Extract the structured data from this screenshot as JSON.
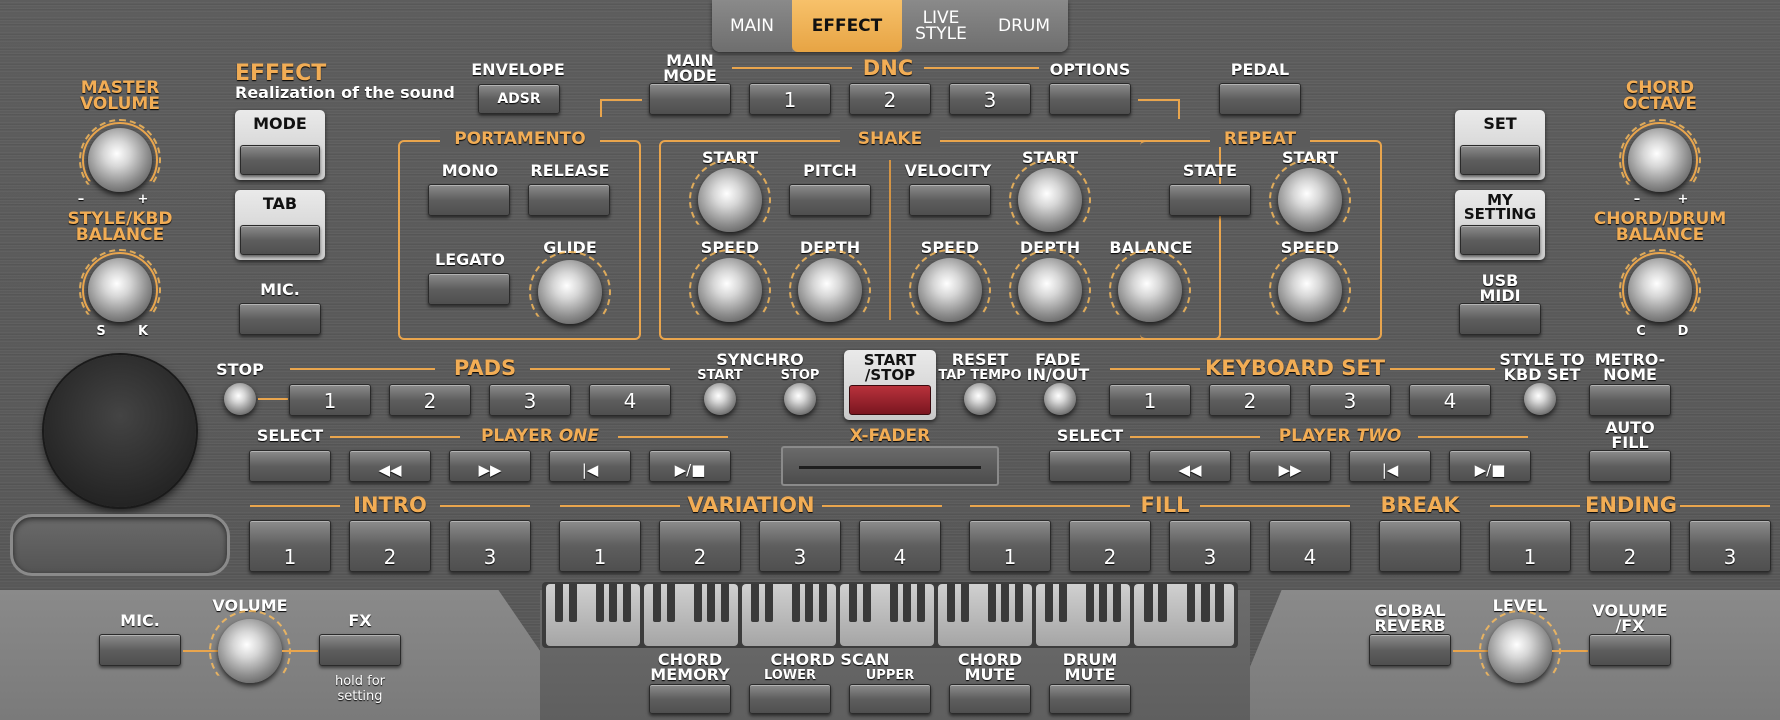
{
  "tabs": [
    {
      "label": "MAIN"
    },
    {
      "label": "EFFECT"
    },
    {
      "label": "LIVE STYLE"
    },
    {
      "label": "DRUM"
    }
  ],
  "left": {
    "master_volume": "MASTER VOLUME",
    "minus": "–",
    "plus": "+",
    "style_kbd_balance": "STYLE/KBD BALANCE",
    "s": "S",
    "k": "K"
  },
  "effect": {
    "title": "EFFECT",
    "subtitle": "Realization of the sound",
    "mode": "MODE",
    "tab": "TAB",
    "mic": "MIC."
  },
  "envelope": {
    "label": "ENVELOPE",
    "adsr": "ADSR"
  },
  "main_mode": "MAIN MODE",
  "dnc": {
    "title": "DNC",
    "b1": "1",
    "b2": "2",
    "b3": "3",
    "options": "OPTIONS"
  },
  "pedal": "PEDAL",
  "portamento": {
    "title": "PORTAMENTO",
    "mono": "MONO",
    "release": "RELEASE",
    "legato": "LEGATO",
    "glide": "GLIDE"
  },
  "shake": {
    "title": "SHAKE",
    "start": "START",
    "pitch": "PITCH",
    "speed": "SPEED",
    "depth": "DEPTH",
    "velocity": "VELOCITY",
    "start2": "START",
    "speed2": "SPEED",
    "depth2": "DEPTH",
    "balance": "BALANCE"
  },
  "repeat": {
    "title": "REPEAT",
    "state": "STATE",
    "start": "START",
    "speed": "SPEED"
  },
  "right": {
    "set": "SET",
    "my_setting": "MY SETTING",
    "usb_midi": "USB MIDI",
    "chord_octave": "CHORD OCTAVE",
    "minus": "–",
    "plus": "+",
    "chord_drum_balance": "CHORD/DRUM BALANCE",
    "c": "C",
    "d": "D"
  },
  "pads": {
    "stop": "STOP",
    "title": "PADS",
    "b1": "1",
    "b2": "2",
    "b3": "3",
    "b4": "4"
  },
  "synchro": {
    "title": "SYNCHRO",
    "start": "START",
    "stop": "STOP"
  },
  "start_stop": "START /STOP",
  "reset": {
    "title": "RESET",
    "sub": "TAP TEMPO"
  },
  "fade": "FADE IN/OUT",
  "keyboard_set": {
    "title": "KEYBOARD SET",
    "b1": "1",
    "b2": "2",
    "b3": "3",
    "b4": "4",
    "style_to_kbd": "STYLE TO KBD SET"
  },
  "metronome": "METRO- NOME",
  "auto_fill": "AUTO FILL",
  "player_one": {
    "select": "SELECT",
    "title": "PLAYER",
    "title2": "ONE",
    "rew": "◀◀",
    "ff": "▶▶",
    "home": "|◀",
    "play": "▶/■"
  },
  "x_fader": "X-FADER",
  "player_two": {
    "select": "SELECT",
    "title": "PLAYER",
    "title2": "TWO",
    "rew": "◀◀",
    "ff": "▶▶",
    "home": "|◀",
    "play": "▶/■"
  },
  "intro": {
    "title": "INTRO",
    "b": [
      "1",
      "2",
      "3"
    ]
  },
  "variation": {
    "title": "VARIATION",
    "b": [
      "1",
      "2",
      "3",
      "4"
    ]
  },
  "fill": {
    "title": "FILL",
    "b": [
      "1",
      "2",
      "3",
      "4"
    ]
  },
  "break": "BREAK",
  "ending": {
    "title": "ENDING",
    "b": [
      "1",
      "2",
      "3"
    ]
  },
  "bottom": {
    "mic": "MIC.",
    "volume": "VOLUME",
    "fx": "FX",
    "hold": "hold for setting",
    "chord_memory": "CHORD MEMORY",
    "chord_scan": "CHORD SCAN",
    "lower": "LOWER",
    "upper": "UPPER",
    "chord_mute": "CHORD MUTE",
    "drum_mute": "DRUM MUTE",
    "global_reverb": "GLOBAL REVERB",
    "level": "LEVEL",
    "volume_fx": "VOLUME /FX"
  },
  "colors": {
    "accent": "#e9a54d",
    "start_stop_red": "#8e1f27"
  }
}
